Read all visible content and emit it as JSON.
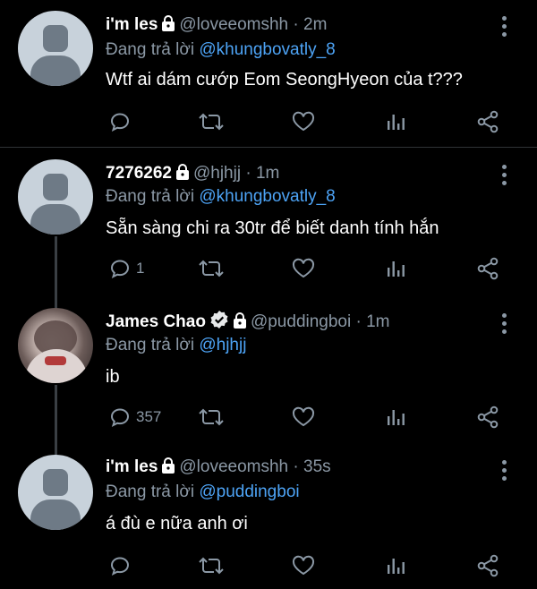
{
  "tweets": [
    {
      "name": "i'm les",
      "handle": "@loveeomshh",
      "separator": "·",
      "time": "2m",
      "replying_prefix": "Đang trả lời",
      "replying_to": "@khungbovatly_8",
      "text": "Wtf ai dám cướp Eom SeongHyeon của t???",
      "reply_count": "",
      "avatar": "default"
    },
    {
      "name": "7276262",
      "handle": "@hjhjj",
      "separator": "·",
      "time": "1m",
      "replying_prefix": "Đang trả lời",
      "replying_to": "@khungbovatly_8",
      "text": "Sẵn sàng chi ra 30tr để biết danh tính hắn",
      "reply_count": "1",
      "avatar": "default"
    },
    {
      "name": "James Chao",
      "handle": "@puddingboi",
      "separator": "·",
      "time": "1m",
      "replying_prefix": "Đang trả lời",
      "replying_to": "@hjhjj",
      "text": "ib",
      "reply_count": "357",
      "avatar": "photo",
      "verified": true
    },
    {
      "name": "i'm les",
      "handle": "@loveeomshh",
      "separator": "·",
      "time": "35s",
      "replying_prefix": "Đang trả lời",
      "replying_to": "@puddingboi",
      "text": "á đù e nữa anh ơi",
      "reply_count": "",
      "avatar": "default"
    }
  ],
  "icons": [
    "reply-icon",
    "retweet-icon",
    "like-icon",
    "analytics-icon",
    "share-icon",
    "lock-icon",
    "verified-icon",
    "more-icon"
  ],
  "colors": {
    "background": "#000000",
    "mention": "#4da3f5",
    "muted": "#8b98a5",
    "verified": "#1d9bf0"
  }
}
